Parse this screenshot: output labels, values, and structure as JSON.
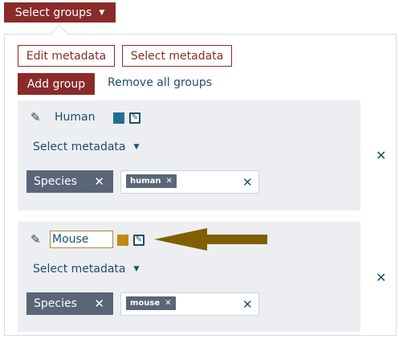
{
  "header": {
    "select_groups_label": "Select groups"
  },
  "toolbar": {
    "edit_metadata_label": "Edit metadata",
    "select_metadata_label": "Select metadata",
    "add_group_label": "Add group",
    "remove_all_label": "Remove all groups"
  },
  "groups": [
    {
      "name": "Human",
      "color": "#1f6f96",
      "select_metadata_label": "Select metadata",
      "filter_label": "Species",
      "tag": "human"
    },
    {
      "name": "Mouse",
      "color": "#c08b14",
      "select_metadata_label": "Select metadata",
      "filter_label": "Species",
      "tag": "mouse"
    }
  ],
  "annotation": {
    "arrow_color": "#7f5f00"
  },
  "icons": {
    "pencil": "✎",
    "close": "✕",
    "caret": "▼",
    "edit_box": "✎"
  }
}
